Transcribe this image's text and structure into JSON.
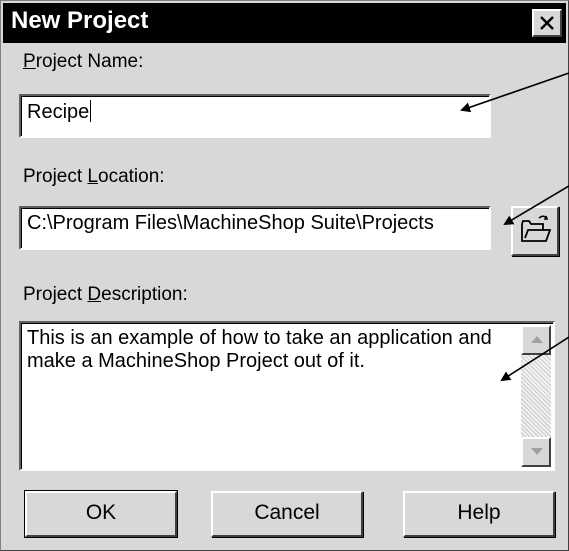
{
  "window": {
    "title": "New Project",
    "close_glyph": "✕"
  },
  "project_name": {
    "label_mnemonic": "P",
    "label_rest": "roject Name:",
    "value": "Recipe"
  },
  "project_location": {
    "label_pre": "Project ",
    "label_mnemonic": "L",
    "label_rest": "ocation:",
    "value": "C:\\Program Files\\MachineShop Suite\\Projects",
    "browse_icon": "open-folder-icon"
  },
  "project_description": {
    "label_pre": "Project ",
    "label_mnemonic": "D",
    "label_rest": "escription:",
    "value": "This is an example of how to take an application and\nmake a MachineShop Project out of it."
  },
  "buttons": {
    "ok": "OK",
    "cancel": "Cancel",
    "help": "Help"
  },
  "colors": {
    "dialog_bg": "#d8d8d8",
    "titlebar_bg": "#000000",
    "title_text": "#ffffff"
  }
}
